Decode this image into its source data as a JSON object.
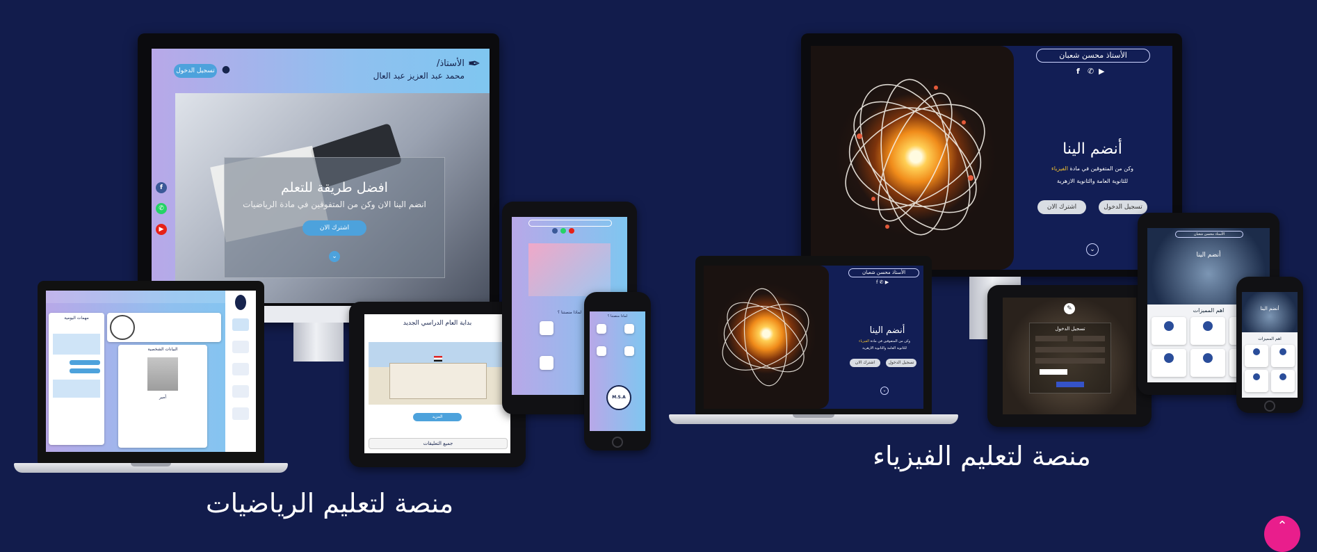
{
  "captions": {
    "physics": "منصة لتعليم الفيزياء",
    "math": "منصة لتعليم الرياضيات"
  },
  "physics_site": {
    "teacher": "الأستاذ محسن شعبان",
    "join_title": "أنضم الينا",
    "join_line1_a": "وكن من المتفوقين في مادة",
    "join_line1_b": "الفيزياء",
    "join_line2": "للثانوية العامة والثانوية الازهرية",
    "register_button": "تسجيل الدخول",
    "subscribe_button": "اشترك الان",
    "features_title": "اهم المميزات",
    "login_title": "تسجيل الدخول"
  },
  "math_site": {
    "teacher_title": "الأستاذ/",
    "teacher_name": "محمد عبد العزيز عبد العال",
    "login_button": "تسجيل الدخول",
    "hero_title": "افضل طريقة للتعلم",
    "hero_subtitle": "انضم الينا الان وكن من المتفوقين في مادة الرياضيات",
    "subscribe_button": "اشترك الان",
    "why_us": "لماذا منصتنا ؟",
    "news_title": "بداية العام الدراسي الجديد",
    "news_button": "المزيد",
    "comments_button": "جميع التعليقات",
    "dash_tasks": "مهمات اليومية",
    "dash_personal": "البيانات الشخصية",
    "dash_name": "أمير",
    "logo_text": "M.S.A"
  },
  "colors": {
    "background": "#121c4c",
    "math_gradient_start": "#b8a8e8",
    "math_gradient_end": "#7fc6f0",
    "physics_panel": "#121e55",
    "accent_yellow": "#f2c230",
    "scroll_top": "#e91e8c"
  },
  "icons": {
    "scroll_top": "chevron-up-icon",
    "down": "chevron-down-icon"
  }
}
